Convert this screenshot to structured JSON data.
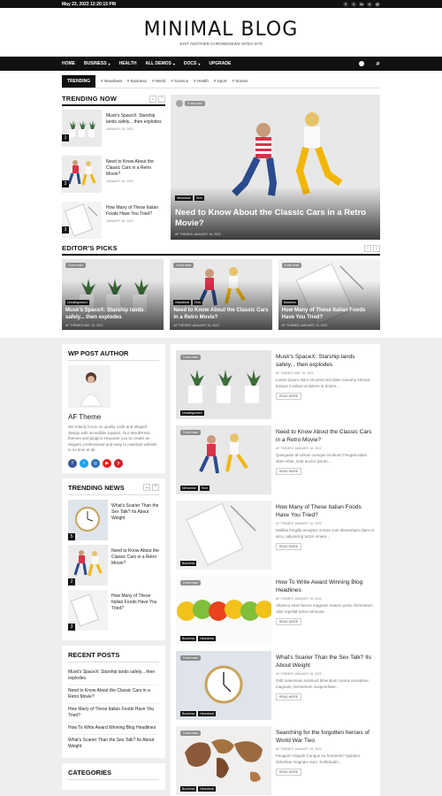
{
  "topbar": {
    "date": "May 23, 2023 12:20:15 PM",
    "socials": [
      "f",
      "t",
      "in",
      "v",
      "@"
    ]
  },
  "site": {
    "title": "MINIMAL BLOG",
    "tagline": "JUST ANOTHER CHROMENEWS SITES SITE"
  },
  "nav": {
    "items": [
      "HOME",
      "BUSINESS",
      "HEALTH",
      "ALL DEMOS",
      "DOCS",
      "UPGRADE"
    ],
    "search_icon": "⌕"
  },
  "trending_bar": {
    "label": "TRENDING",
    "tags": [
      "Newsbeat",
      "Business",
      "World",
      "Science",
      "Health",
      "Sport",
      "Stories"
    ]
  },
  "trending_now": {
    "title": "TRENDING NOW",
    "items": [
      {
        "num": "1",
        "title": "Musk's SpaceX: Starship lands safely... then explodes",
        "meta": "JANUARY 15, 2022"
      },
      {
        "num": "2",
        "title": "Need to Know About the Classic Cars in a Retro Movie?",
        "meta": "JANUARY 16, 2022"
      },
      {
        "num": "3",
        "title": "How Many of These Italian Foods Have You Tried?",
        "meta": "JANUARY 16, 2022"
      }
    ]
  },
  "hero": {
    "read_time": "3 min read",
    "cats": [
      "Newsbeat",
      "Tech"
    ],
    "title": "Need to Know About the Classic Cars in a Retro Movie?",
    "meta": "AF THEMES   JANUARY 16, 2022"
  },
  "editors_picks": {
    "title": "EDITOR'S PICKS",
    "cards": [
      {
        "read_time": "3 min read",
        "cats": [
          "Uncategorized"
        ],
        "title": "Musk's SpaceX: Starship lands safely... then explodes",
        "meta": "AF THEMES   MAY 15, 2021"
      },
      {
        "read_time": "3 min read",
        "cats": [
          "Newsbeat",
          "Tech"
        ],
        "title": "Need to Know About the Classic Cars in a Retro Movie?",
        "meta": "AF THEMES   JANUARY 16, 2022"
      },
      {
        "read_time": "3 min read",
        "cats": [
          "Business"
        ],
        "title": "How Many of These Italian Foods Have You Tried?",
        "meta": "AF THEMES   JANUARY 16, 2022"
      }
    ]
  },
  "author_widget": {
    "title": "WP POST AUTHOR",
    "name": "AF Theme",
    "desc": "We mainly focus on quality code and elegant design with incredible support. Our WordPress themes and plugins empower you to create an elegant, professional and easy to maintain website in no time at all."
  },
  "trending_news": {
    "title": "TRENDING NEWS",
    "items": [
      {
        "num": "5",
        "title": "What's Scarier Than the Sex Talk? Its About Weight"
      },
      {
        "num": "2",
        "title": "Need to Know About the Classic Cars in a Retro Movie?"
      },
      {
        "num": "3",
        "title": "How Many of These Italian Foods Have You Tried?"
      }
    ]
  },
  "recent_posts": {
    "title": "RECENT POSTS",
    "items": [
      "Musk's SpaceX: Starship lands safely... then explodes",
      "Need to Know About the Classic Cars in a Retro Movie?",
      "How Many of These Italian Foods Have You Tried?",
      "How To Write Award Winning Blog Headlines",
      "What's Scarier Than the Sex Talk? Its About Weight"
    ]
  },
  "categories": {
    "title": "CATEGORIES"
  },
  "posts": [
    {
      "read_time": "3 min read",
      "cats": [
        "Uncategorized"
      ],
      "title": "Musk's SpaceX: Starship lands safely... then explodes",
      "meta": "AF THEMES   MAY 15, 2021",
      "excerpt": "Lorem ipsum dolor sit amet,sed diam nonumy eirmod tempor invidunt ut labore et dolore...",
      "more": "READ MORE"
    },
    {
      "read_time": "3 min read",
      "cats": [
        "Newsbeat",
        "Tech"
      ],
      "title": "Need to Know About the Classic Cars in a Retro Movie?",
      "meta": "AF THEMES   JANUARY 16, 2022",
      "excerpt": "Quisquam id rutrum cumque incidunt! Feugiat etiam diam vitae, sunt auctor ipsum...",
      "more": "READ MORE"
    },
    {
      "read_time": "",
      "cats": [
        "Business"
      ],
      "title": "How Many of These Italian Foods Have You Tried?",
      "meta": "AF THEMES   JANUARY 16, 2022",
      "excerpt": "Mollitia fringilla inceptos ornare cum elementum diam et arcu, adipiscing tortor ornare...",
      "more": "READ MORE"
    },
    {
      "read_time": "3 min read",
      "cats": [
        "Business",
        "Newsbeat"
      ],
      "title": "How To Write Award Winning Blog Headlines",
      "meta": "AF THEMES   JANUARY 16, 2022",
      "excerpt": "Ullamco esse facere magnam mauris porta, fermentum odio repellat tortor vehicula...",
      "more": "READ MORE"
    },
    {
      "read_time": "3 min read",
      "cats": [
        "Business",
        "Newsbeat"
      ],
      "title": "What's Scarier Than the Sex Talk? Its About Weight",
      "meta": "AF THEMES   JANUARY 16, 2022",
      "excerpt": "Odit maecenas euismod bibendum cursus excepteur magnam, fermentum suspendisse...",
      "more": "READ MORE"
    },
    {
      "read_time": "3 min read",
      "cats": [
        "Business",
        "Newsbeat"
      ],
      "title": "Searching for the forgotten heroes of World War Two",
      "meta": "AF THEMES   JANUARY 16, 2022",
      "excerpt": "Feugiat? Aliquid! Congue eu hendrerit? Quidem doloribus magnam sunt. Sollicitudin...",
      "more": "READ MORE"
    }
  ]
}
